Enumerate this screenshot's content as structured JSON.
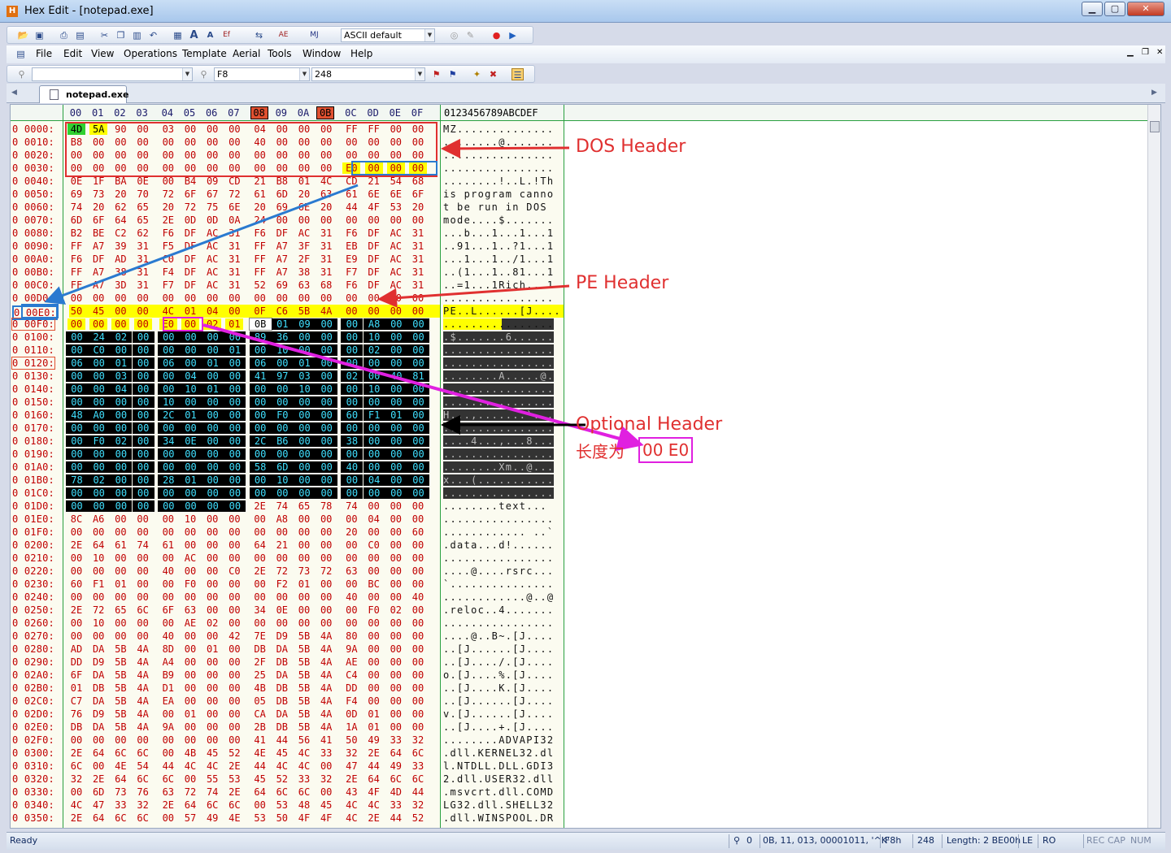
{
  "window": {
    "title": "Hex Edit - [notepad.exe]",
    "min_glyph": "▁",
    "max_glyph": "▢",
    "close_glyph": "✕"
  },
  "toolbar1": {
    "charset_combo": "ASCII default"
  },
  "menubar": {
    "items": [
      "File",
      "Edit",
      "View",
      "Operations",
      "Template",
      "Aerial",
      "Tools",
      "Window",
      "Help"
    ]
  },
  "toolbar3": {
    "search_value": "",
    "hex_value": "F8",
    "dec_value": "248"
  },
  "tabs": [
    {
      "label": "notepad.exe"
    }
  ],
  "column_header": {
    "cols": [
      "00",
      "01",
      "02",
      "03",
      "04",
      "05",
      "06",
      "07",
      "08",
      "09",
      "0A",
      "0B",
      "0C",
      "0D",
      "0E",
      "0F"
    ],
    "ascii_ruler": "0123456789ABCDEF"
  },
  "hex_rows": [
    {
      "addr": "0 0000:",
      "bytes": [
        "4D",
        "5A",
        "90",
        "00",
        "03",
        "00",
        "00",
        "00",
        "04",
        "00",
        "00",
        "00",
        "FF",
        "FF",
        "00",
        "00"
      ],
      "ascii": "MZ.............."
    },
    {
      "addr": "0 0010:",
      "bytes": [
        "B8",
        "00",
        "00",
        "00",
        "00",
        "00",
        "00",
        "00",
        "40",
        "00",
        "00",
        "00",
        "00",
        "00",
        "00",
        "00"
      ],
      "ascii": "........@......."
    },
    {
      "addr": "0 0020:",
      "bytes": [
        "00",
        "00",
        "00",
        "00",
        "00",
        "00",
        "00",
        "00",
        "00",
        "00",
        "00",
        "00",
        "00",
        "00",
        "00",
        "00"
      ],
      "ascii": "................"
    },
    {
      "addr": "0 0030:",
      "bytes": [
        "00",
        "00",
        "00",
        "00",
        "00",
        "00",
        "00",
        "00",
        "00",
        "00",
        "00",
        "00",
        "E0",
        "00",
        "00",
        "00"
      ],
      "ascii": "................"
    },
    {
      "addr": "0 0040:",
      "bytes": [
        "0E",
        "1F",
        "BA",
        "0E",
        "00",
        "B4",
        "09",
        "CD",
        "21",
        "B8",
        "01",
        "4C",
        "CD",
        "21",
        "54",
        "68"
      ],
      "ascii": "........!..L.!Th"
    },
    {
      "addr": "0 0050:",
      "bytes": [
        "69",
        "73",
        "20",
        "70",
        "72",
        "6F",
        "67",
        "72",
        "61",
        "6D",
        "20",
        "63",
        "61",
        "6E",
        "6E",
        "6F"
      ],
      "ascii": "is program canno"
    },
    {
      "addr": "0 0060:",
      "bytes": [
        "74",
        "20",
        "62",
        "65",
        "20",
        "72",
        "75",
        "6E",
        "20",
        "69",
        "6E",
        "20",
        "44",
        "4F",
        "53",
        "20"
      ],
      "ascii": "t be run in DOS "
    },
    {
      "addr": "0 0070:",
      "bytes": [
        "6D",
        "6F",
        "64",
        "65",
        "2E",
        "0D",
        "0D",
        "0A",
        "24",
        "00",
        "00",
        "00",
        "00",
        "00",
        "00",
        "00"
      ],
      "ascii": "mode....$......."
    },
    {
      "addr": "0 0080:",
      "bytes": [
        "B2",
        "BE",
        "C2",
        "62",
        "F6",
        "DF",
        "AC",
        "31",
        "F6",
        "DF",
        "AC",
        "31",
        "F6",
        "DF",
        "AC",
        "31"
      ],
      "ascii": "...b...1...1...1"
    },
    {
      "addr": "0 0090:",
      "bytes": [
        "FF",
        "A7",
        "39",
        "31",
        "F5",
        "DF",
        "AC",
        "31",
        "FF",
        "A7",
        "3F",
        "31",
        "EB",
        "DF",
        "AC",
        "31"
      ],
      "ascii": "..91...1..?1...1"
    },
    {
      "addr": "0 00A0:",
      "bytes": [
        "F6",
        "DF",
        "AD",
        "31",
        "C0",
        "DF",
        "AC",
        "31",
        "FF",
        "A7",
        "2F",
        "31",
        "E9",
        "DF",
        "AC",
        "31"
      ],
      "ascii": "...1...1../1...1"
    },
    {
      "addr": "0 00B0:",
      "bytes": [
        "FF",
        "A7",
        "38",
        "31",
        "F4",
        "DF",
        "AC",
        "31",
        "FF",
        "A7",
        "38",
        "31",
        "F7",
        "DF",
        "AC",
        "31"
      ],
      "ascii": "..(1...1..81...1"
    },
    {
      "addr": "0 00C0:",
      "bytes": [
        "FF",
        "A7",
        "3D",
        "31",
        "F7",
        "DF",
        "AC",
        "31",
        "52",
        "69",
        "63",
        "68",
        "F6",
        "DF",
        "AC",
        "31"
      ],
      "ascii": "..=1...1Rich...1"
    },
    {
      "addr": "0 00D0:",
      "bytes": [
        "00",
        "00",
        "00",
        "00",
        "00",
        "00",
        "00",
        "00",
        "00",
        "00",
        "00",
        "00",
        "00",
        "00",
        "00",
        "00"
      ],
      "ascii": "................"
    },
    {
      "addr": "0 00E0:",
      "bytes": [
        "50",
        "45",
        "00",
        "00",
        "4C",
        "01",
        "04",
        "00",
        "0F",
        "C6",
        "5B",
        "4A",
        "00",
        "00",
        "00",
        "00"
      ],
      "ascii": "PE..L......[J...."
    },
    {
      "addr": "0 00F0:",
      "bytes": [
        "00",
        "00",
        "00",
        "00",
        "E0",
        "00",
        "02",
        "01",
        "0B",
        "01",
        "09",
        "00",
        "00",
        "A8",
        "00",
        "00"
      ],
      "ascii": "................"
    },
    {
      "addr": "0 0100:",
      "bytes": [
        "00",
        "24",
        "02",
        "00",
        "00",
        "00",
        "00",
        "00",
        "89",
        "36",
        "00",
        "00",
        "00",
        "10",
        "00",
        "00"
      ],
      "ascii": ".$.......6......"
    },
    {
      "addr": "0 0110:",
      "bytes": [
        "00",
        "C0",
        "00",
        "00",
        "00",
        "00",
        "00",
        "01",
        "00",
        "10",
        "00",
        "00",
        "00",
        "02",
        "00",
        "00"
      ],
      "ascii": "................"
    },
    {
      "addr": "0 0120:",
      "bytes": [
        "06",
        "00",
        "01",
        "00",
        "06",
        "00",
        "01",
        "00",
        "06",
        "00",
        "01",
        "00",
        "00",
        "00",
        "00",
        "00"
      ],
      "ascii": "................"
    },
    {
      "addr": "0 0130:",
      "bytes": [
        "00",
        "00",
        "03",
        "00",
        "00",
        "04",
        "00",
        "00",
        "41",
        "97",
        "03",
        "00",
        "02",
        "00",
        "40",
        "81"
      ],
      "ascii": "........A.....@."
    },
    {
      "addr": "0 0140:",
      "bytes": [
        "00",
        "00",
        "04",
        "00",
        "00",
        "10",
        "01",
        "00",
        "00",
        "00",
        "10",
        "00",
        "00",
        "10",
        "00",
        "00"
      ],
      "ascii": "................"
    },
    {
      "addr": "0 0150:",
      "bytes": [
        "00",
        "00",
        "00",
        "00",
        "10",
        "00",
        "00",
        "00",
        "00",
        "00",
        "00",
        "00",
        "00",
        "00",
        "00",
        "00"
      ],
      "ascii": "................"
    },
    {
      "addr": "0 0160:",
      "bytes": [
        "48",
        "A0",
        "00",
        "00",
        "2C",
        "01",
        "00",
        "00",
        "00",
        "F0",
        "00",
        "00",
        "60",
        "F1",
        "01",
        "00"
      ],
      "ascii": "H...,.......`..."
    },
    {
      "addr": "0 0170:",
      "bytes": [
        "00",
        "00",
        "00",
        "00",
        "00",
        "00",
        "00",
        "00",
        "00",
        "00",
        "00",
        "00",
        "00",
        "00",
        "00",
        "00"
      ],
      "ascii": "................"
    },
    {
      "addr": "0 0180:",
      "bytes": [
        "00",
        "F0",
        "02",
        "00",
        "34",
        "0E",
        "00",
        "00",
        "2C",
        "B6",
        "00",
        "00",
        "38",
        "00",
        "00",
        "00"
      ],
      "ascii": "....4...,...8..."
    },
    {
      "addr": "0 0190:",
      "bytes": [
        "00",
        "00",
        "00",
        "00",
        "00",
        "00",
        "00",
        "00",
        "00",
        "00",
        "00",
        "00",
        "00",
        "00",
        "00",
        "00"
      ],
      "ascii": "................"
    },
    {
      "addr": "0 01A0:",
      "bytes": [
        "00",
        "00",
        "00",
        "00",
        "00",
        "00",
        "00",
        "00",
        "58",
        "6D",
        "00",
        "00",
        "40",
        "00",
        "00",
        "00"
      ],
      "ascii": "........Xm..@..."
    },
    {
      "addr": "0 01B0:",
      "bytes": [
        "78",
        "02",
        "00",
        "00",
        "28",
        "01",
        "00",
        "00",
        "00",
        "10",
        "00",
        "00",
        "00",
        "04",
        "00",
        "00"
      ],
      "ascii": "x...(..........."
    },
    {
      "addr": "0 01C0:",
      "bytes": [
        "00",
        "00",
        "00",
        "00",
        "00",
        "00",
        "00",
        "00",
        "00",
        "00",
        "00",
        "00",
        "00",
        "00",
        "00",
        "00"
      ],
      "ascii": "................"
    },
    {
      "addr": "0 01D0:",
      "bytes": [
        "00",
        "00",
        "00",
        "00",
        "00",
        "00",
        "00",
        "00",
        "2E",
        "74",
        "65",
        "78",
        "74",
        "00",
        "00",
        "00"
      ],
      "ascii": "........text..."
    },
    {
      "addr": "0 01E0:",
      "bytes": [
        "8C",
        "A6",
        "00",
        "00",
        "00",
        "10",
        "00",
        "00",
        "00",
        "A8",
        "00",
        "00",
        "00",
        "04",
        "00",
        "00"
      ],
      "ascii": "................"
    },
    {
      "addr": "0 01F0:",
      "bytes": [
        "00",
        "00",
        "00",
        "00",
        "00",
        "00",
        "00",
        "00",
        "00",
        "00",
        "00",
        "00",
        "20",
        "00",
        "00",
        "60"
      ],
      "ascii": "............ ..`"
    },
    {
      "addr": "0 0200:",
      "bytes": [
        "2E",
        "64",
        "61",
        "74",
        "61",
        "00",
        "00",
        "00",
        "64",
        "21",
        "00",
        "00",
        "00",
        "C0",
        "00",
        "00"
      ],
      "ascii": ".data...d!......"
    },
    {
      "addr": "0 0210:",
      "bytes": [
        "00",
        "10",
        "00",
        "00",
        "00",
        "AC",
        "00",
        "00",
        "00",
        "00",
        "00",
        "00",
        "00",
        "00",
        "00",
        "00"
      ],
      "ascii": "................"
    },
    {
      "addr": "0 0220:",
      "bytes": [
        "00",
        "00",
        "00",
        "00",
        "40",
        "00",
        "00",
        "C0",
        "2E",
        "72",
        "73",
        "72",
        "63",
        "00",
        "00",
        "00"
      ],
      "ascii": "....@....rsrc..."
    },
    {
      "addr": "0 0230:",
      "bytes": [
        "60",
        "F1",
        "01",
        "00",
        "00",
        "F0",
        "00",
        "00",
        "00",
        "F2",
        "01",
        "00",
        "00",
        "BC",
        "00",
        "00"
      ],
      "ascii": "`..............."
    },
    {
      "addr": "0 0240:",
      "bytes": [
        "00",
        "00",
        "00",
        "00",
        "00",
        "00",
        "00",
        "00",
        "00",
        "00",
        "00",
        "00",
        "40",
        "00",
        "00",
        "40"
      ],
      "ascii": "............@..@"
    },
    {
      "addr": "0 0250:",
      "bytes": [
        "2E",
        "72",
        "65",
        "6C",
        "6F",
        "63",
        "00",
        "00",
        "34",
        "0E",
        "00",
        "00",
        "00",
        "F0",
        "02",
        "00"
      ],
      "ascii": ".reloc..4......."
    },
    {
      "addr": "0 0260:",
      "bytes": [
        "00",
        "10",
        "00",
        "00",
        "00",
        "AE",
        "02",
        "00",
        "00",
        "00",
        "00",
        "00",
        "00",
        "00",
        "00",
        "00"
      ],
      "ascii": "................"
    },
    {
      "addr": "0 0270:",
      "bytes": [
        "00",
        "00",
        "00",
        "00",
        "40",
        "00",
        "00",
        "42",
        "7E",
        "D9",
        "5B",
        "4A",
        "80",
        "00",
        "00",
        "00"
      ],
      "ascii": "....@..B~.[J...."
    },
    {
      "addr": "0 0280:",
      "bytes": [
        "AD",
        "DA",
        "5B",
        "4A",
        "8D",
        "00",
        "01",
        "00",
        "DB",
        "DA",
        "5B",
        "4A",
        "9A",
        "00",
        "00",
        "00"
      ],
      "ascii": "..[J......[J...."
    },
    {
      "addr": "0 0290:",
      "bytes": [
        "DD",
        "D9",
        "5B",
        "4A",
        "A4",
        "00",
        "00",
        "00",
        "2F",
        "DB",
        "5B",
        "4A",
        "AE",
        "00",
        "00",
        "00"
      ],
      "ascii": "..[J..../.[J...."
    },
    {
      "addr": "0 02A0:",
      "bytes": [
        "6F",
        "DA",
        "5B",
        "4A",
        "B9",
        "00",
        "00",
        "00",
        "25",
        "DA",
        "5B",
        "4A",
        "C4",
        "00",
        "00",
        "00"
      ],
      "ascii": "o.[J....%.[J...."
    },
    {
      "addr": "0 02B0:",
      "bytes": [
        "01",
        "DB",
        "5B",
        "4A",
        "D1",
        "00",
        "00",
        "00",
        "4B",
        "DB",
        "5B",
        "4A",
        "DD",
        "00",
        "00",
        "00"
      ],
      "ascii": "..[J....K.[J...."
    },
    {
      "addr": "0 02C0:",
      "bytes": [
        "C7",
        "DA",
        "5B",
        "4A",
        "EA",
        "00",
        "00",
        "00",
        "05",
        "DB",
        "5B",
        "4A",
        "F4",
        "00",
        "00",
        "00"
      ],
      "ascii": "..[J......[J...."
    },
    {
      "addr": "0 02D0:",
      "bytes": [
        "76",
        "D9",
        "5B",
        "4A",
        "00",
        "01",
        "00",
        "00",
        "CA",
        "DA",
        "5B",
        "4A",
        "0D",
        "01",
        "00",
        "00"
      ],
      "ascii": "v.[J......[J...."
    },
    {
      "addr": "0 02E0:",
      "bytes": [
        "DB",
        "DA",
        "5B",
        "4A",
        "9A",
        "00",
        "00",
        "00",
        "2B",
        "DB",
        "5B",
        "4A",
        "1A",
        "01",
        "00",
        "00"
      ],
      "ascii": "..[J....+.[J...."
    },
    {
      "addr": "0 02F0:",
      "bytes": [
        "00",
        "00",
        "00",
        "00",
        "00",
        "00",
        "00",
        "00",
        "41",
        "44",
        "56",
        "41",
        "50",
        "49",
        "33",
        "32"
      ],
      "ascii": "........ADVAPI32"
    },
    {
      "addr": "0 0300:",
      "bytes": [
        "2E",
        "64",
        "6C",
        "6C",
        "00",
        "4B",
        "45",
        "52",
        "4E",
        "45",
        "4C",
        "33",
        "32",
        "2E",
        "64",
        "6C"
      ],
      "ascii": ".dll.KERNEL32.dl"
    },
    {
      "addr": "0 0310:",
      "bytes": [
        "6C",
        "00",
        "4E",
        "54",
        "44",
        "4C",
        "4C",
        "2E",
        "44",
        "4C",
        "4C",
        "00",
        "47",
        "44",
        "49",
        "33"
      ],
      "ascii": "l.NTDLL.DLL.GDI3"
    },
    {
      "addr": "0 0320:",
      "bytes": [
        "32",
        "2E",
        "64",
        "6C",
        "6C",
        "00",
        "55",
        "53",
        "45",
        "52",
        "33",
        "32",
        "2E",
        "64",
        "6C",
        "6C"
      ],
      "ascii": "2.dll.USER32.dll"
    },
    {
      "addr": "0 0330:",
      "bytes": [
        "00",
        "6D",
        "73",
        "76",
        "63",
        "72",
        "74",
        "2E",
        "64",
        "6C",
        "6C",
        "00",
        "43",
        "4F",
        "4D",
        "44"
      ],
      "ascii": ".msvcrt.dll.COMD"
    },
    {
      "addr": "0 0340:",
      "bytes": [
        "4C",
        "47",
        "33",
        "32",
        "2E",
        "64",
        "6C",
        "6C",
        "00",
        "53",
        "48",
        "45",
        "4C",
        "4C",
        "33",
        "32"
      ],
      "ascii": "LG32.dll.SHELL32"
    },
    {
      "addr": "0 0350:",
      "bytes": [
        "2E",
        "64",
        "6C",
        "6C",
        "00",
        "57",
        "49",
        "4E",
        "53",
        "50",
        "4F",
        "4F",
        "4C",
        "2E",
        "44",
        "52"
      ],
      "ascii": ".dll.WINSPOOL.DR"
    }
  ],
  "annotations": {
    "dos_header": "DOS Header",
    "pe_header": "PE Header",
    "optional_header": "Optional Header",
    "optional_len_label": "长度为",
    "optional_len_value": "00 E0"
  },
  "statusbar": {
    "ready": "Ready",
    "count": "0",
    "values": "0B, 11, 013, 00001011, '^K'",
    "hex": "F8h",
    "dec": "248",
    "length": "Length: 2 BE00h",
    "le": "LE",
    "ro": "RO",
    "rec": "REC",
    "cap": "CAP",
    "num": "NUM"
  },
  "colors": {
    "dos_box": "#e03030",
    "e0_box": "#2a7ad0",
    "optional_box": "#e020e0",
    "pe_highlight": "#ffff00",
    "optional_bg": "#000000",
    "optional_text": "#40e0ff"
  }
}
